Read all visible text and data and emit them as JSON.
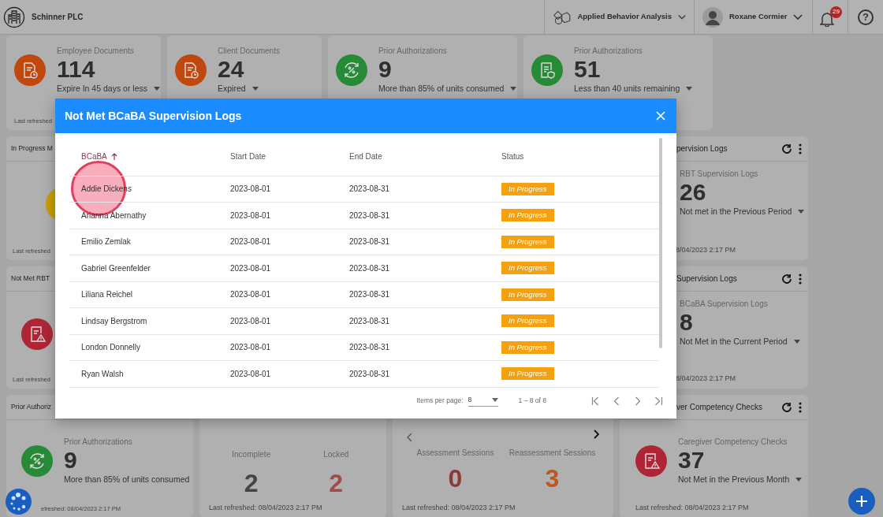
{
  "header": {
    "company": "Schinner PLC",
    "department": "Applied Behavior Analysis",
    "user": "Roxane Cormier",
    "notifications": "29",
    "help": "?"
  },
  "summary_cards": [
    {
      "label": "Employee Documents",
      "value": "114",
      "caption": "Expire In 45 days or less",
      "color": "#c0470e",
      "refreshed": "Last refreshed"
    },
    {
      "label": "Client Documents",
      "value": "24",
      "caption": "Expired",
      "color": "#c0470e"
    },
    {
      "label": "Prior Authorizations",
      "value": "9",
      "caption": "More than 85% of units consumed",
      "color": "#268a36"
    },
    {
      "label": "Prior Authorizations",
      "value": "51",
      "caption": "Less than 40 units remaining",
      "color": "#268a36"
    }
  ],
  "widgets": [
    {
      "kind": "stat",
      "title": "In Progress M",
      "color": "#c9a000",
      "refreshed": "Last refreshed"
    },
    {
      "kind": "stat",
      "title": "pervision Logs",
      "actions": true,
      "label": "RBT Supervision Logs",
      "value": "26",
      "caption": "Not met in the Previous Period",
      "refreshed": "8/04/2023 2:17 PM"
    },
    {
      "kind": "stat",
      "title": "Not Met RBT",
      "color": "#b02535",
      "refreshed": "Last refreshed"
    },
    {
      "kind": "stat",
      "title": "Supervision Logs",
      "actions": true,
      "label": "BCaBA Supervision Logs",
      "value": "8",
      "caption": "Not Met in the Current Period",
      "refreshed": "8/04/2023 2:17 PM"
    },
    {
      "kind": "stat",
      "title": "Prior Authoriz",
      "color": "#268a36",
      "label": "Prior Authorizations",
      "value": "9",
      "caption": "More than 85% of units consumed",
      "refreshed": "efreshed: 08/04/2023 2:17 PM"
    },
    {
      "kind": "metrics",
      "metrics": [
        {
          "label": "Incomplete",
          "value": "2",
          "color": "#444444"
        },
        {
          "label": "Locked",
          "value": "2",
          "color": "#a04a4a"
        }
      ],
      "refreshed": "Last refreshed: 08/04/2023 2:17 PM"
    },
    {
      "kind": "metrics",
      "pager": true,
      "metrics": [
        {
          "label": "Assessment Sessions",
          "value": "0",
          "color": "#8b3a3a"
        },
        {
          "label": "Reassessment Sessions",
          "value": "3",
          "color": "#c0561e"
        }
      ],
      "refreshed": "Last refreshed: 08/04/2023 2:17 PM"
    },
    {
      "kind": "stat",
      "title": "ver Competency Checks",
      "actions": true,
      "color": "#b02535",
      "label": "Caregiver Competency Checks",
      "value": "37",
      "caption": "Not Met in the Previous Month",
      "refreshed": "Last refreshed: 08/04/2023 2:17 PM"
    }
  ],
  "dialog": {
    "title": "Not Met BCaBA Supervision Logs",
    "columns": [
      {
        "label": "BCaBA",
        "sorted": true
      },
      {
        "label": "Start Date",
        "sorted": false
      },
      {
        "label": "End Date",
        "sorted": false
      },
      {
        "label": "Status",
        "sorted": false
      }
    ],
    "rows": [
      {
        "name": "Addie Dickens",
        "start": "2023-08-01",
        "end": "2023-08-31",
        "status": {
          "text": "In Progress",
          "kind": "in-progress"
        }
      },
      {
        "name": "Arianna Abernathy",
        "start": "2023-08-01",
        "end": "2023-08-31",
        "status": {
          "text": "In Progress",
          "kind": "in-progress"
        }
      },
      {
        "name": "Emilio Zemlak",
        "start": "2023-08-01",
        "end": "2023-08-31",
        "status": {
          "text": "In Progress",
          "kind": "in-progress"
        }
      },
      {
        "name": "Gabriel Greenfelder",
        "start": "2023-08-01",
        "end": "2023-08-31",
        "status": {
          "text": "In Progress",
          "kind": "in-progress"
        }
      },
      {
        "name": "Liliana Reichel",
        "start": "2023-08-01",
        "end": "2023-08-31",
        "status": {
          "text": "In Progress",
          "kind": "in-progress"
        }
      },
      {
        "name": "Lindsay Bergstrom",
        "start": "2023-08-01",
        "end": "2023-08-31",
        "status": {
          "text": "In Progress",
          "kind": "in-progress"
        }
      },
      {
        "name": "London Donnelly",
        "start": "2023-08-01",
        "end": "2023-08-31",
        "status": {
          "text": "In Progress",
          "kind": "in-progress"
        }
      },
      {
        "name": "Ryan Walsh",
        "start": "2023-08-01",
        "end": "2023-08-31",
        "status": {
          "text": "In Progress",
          "kind": "in-progress"
        }
      }
    ],
    "paginator": {
      "label": "Items per page:",
      "page_size": "8",
      "range": "1 – 8 of 8"
    }
  }
}
